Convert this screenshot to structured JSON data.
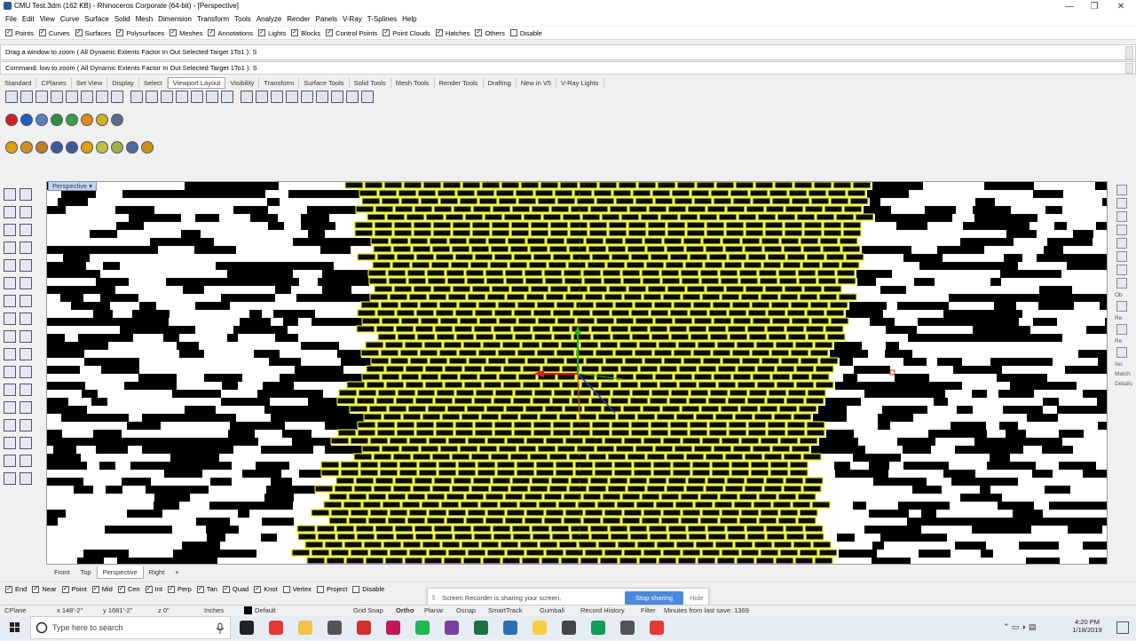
{
  "window": {
    "title": "CMU Test.3dm (162 KB) - Rhinoceros Corporate (64-bit) - [Perspective]",
    "min": "—",
    "max": "❐",
    "close": "✕"
  },
  "menu": [
    "File",
    "Edit",
    "View",
    "Curve",
    "Surface",
    "Solid",
    "Mesh",
    "Dimension",
    "Transform",
    "Tools",
    "Analyze",
    "Render",
    "Panels",
    "V-Ray",
    "T-Splines",
    "Help"
  ],
  "filters": [
    {
      "label": "Points",
      "checked": true
    },
    {
      "label": "Curves",
      "checked": true
    },
    {
      "label": "Surfaces",
      "checked": true
    },
    {
      "label": "Polysurfaces",
      "checked": true
    },
    {
      "label": "Meshes",
      "checked": true
    },
    {
      "label": "Annotations",
      "checked": true
    },
    {
      "label": "Lights",
      "checked": true
    },
    {
      "label": "Blocks",
      "checked": true
    },
    {
      "label": "Control Points",
      "checked": true
    },
    {
      "label": "Point Clouds",
      "checked": true
    },
    {
      "label": "Hatches",
      "checked": true
    },
    {
      "label": "Others",
      "checked": true
    },
    {
      "label": "Disable",
      "checked": false
    }
  ],
  "command": {
    "history": "Drag a window to zoom ( All  Dynamic  Extents  Factor  In  Out  Selected  Target  1To1 ): S",
    "prompt": "Command: low to zoom ( All  Dynamic  Extents  Factor  In  Out  Selected  Target  1To1 ): S"
  },
  "toolbar_tabs": [
    "Standard",
    "CPlanes",
    "Set View",
    "Display",
    "Select",
    "Viewport Layout",
    "Visibility",
    "Transform",
    "Surface Tools",
    "Solid Tools",
    "Mesh Tools",
    "Render Tools",
    "Drafting",
    "New in V5",
    "V-Ray Lights"
  ],
  "active_toolbar_tab": "Viewport Layout",
  "viewport": {
    "title": "Perspective"
  },
  "right_dock_labels": [
    "Ob",
    "Re",
    "Re",
    "Iso",
    "Match",
    "Details"
  ],
  "view_tabs": [
    "Front",
    "Top",
    "Perspective",
    "Right"
  ],
  "active_view": "Perspective",
  "view_tab_add": "+",
  "osnaps": [
    {
      "label": "End",
      "checked": true
    },
    {
      "label": "Near",
      "checked": true
    },
    {
      "label": "Point",
      "checked": true
    },
    {
      "label": "Mid",
      "checked": true
    },
    {
      "label": "Cen",
      "checked": true
    },
    {
      "label": "Int",
      "checked": true
    },
    {
      "label": "Perp",
      "checked": true
    },
    {
      "label": "Tan",
      "checked": true
    },
    {
      "label": "Quad",
      "checked": true
    },
    {
      "label": "Knot",
      "checked": true
    },
    {
      "label": "Vertex",
      "checked": false
    },
    {
      "label": "Project",
      "checked": false
    },
    {
      "label": "Disable",
      "checked": false
    }
  ],
  "recorder": {
    "grip": "⦀",
    "message": "Screen Recorder is sharing your screen.",
    "stop": "Stop sharing",
    "hide": "Hide"
  },
  "status": {
    "cplane": "CPlane",
    "x": "x 148'-2\"",
    "y": "y 1681'-2\"",
    "z": "z 0\"",
    "units": "Inches",
    "layer": "Default",
    "layer_color": "#000000",
    "buttons": [
      "Grid Snap",
      "Ortho",
      "Planar",
      "Osnap",
      "SmartTrack",
      "Gumball",
      "Record History",
      "Filter"
    ],
    "last_save": "Minutes from last save: 1369"
  },
  "taskbar": {
    "search_placeholder": "Type here to search",
    "time": "4:20 PM",
    "date": "1/18/2019",
    "apps": [
      {
        "name": "task-view",
        "color": "#222222"
      },
      {
        "name": "chrome",
        "color": "#e53935"
      },
      {
        "name": "file-explorer",
        "color": "#f2c14e"
      },
      {
        "name": "rhino",
        "color": "#555555"
      },
      {
        "name": "acrobat",
        "color": "#d32f2f"
      },
      {
        "name": "indesign",
        "color": "#c2185b"
      },
      {
        "name": "spotify",
        "color": "#1db954"
      },
      {
        "name": "onenote",
        "color": "#7b3fa0"
      },
      {
        "name": "excel",
        "color": "#1e7145"
      },
      {
        "name": "edge",
        "color": "#2f6fb7"
      },
      {
        "name": "sticky-notes",
        "color": "#f4d03f"
      },
      {
        "name": "calculator",
        "color": "#444444"
      },
      {
        "name": "hangouts",
        "color": "#0f9d58"
      },
      {
        "name": "app-2",
        "color": "#555555"
      },
      {
        "name": "chrome-2",
        "color": "#e53935"
      }
    ]
  },
  "colors": {
    "selection": "#e4e800",
    "viewport_bg": "#ffffff",
    "accent": "#4a89dc"
  }
}
